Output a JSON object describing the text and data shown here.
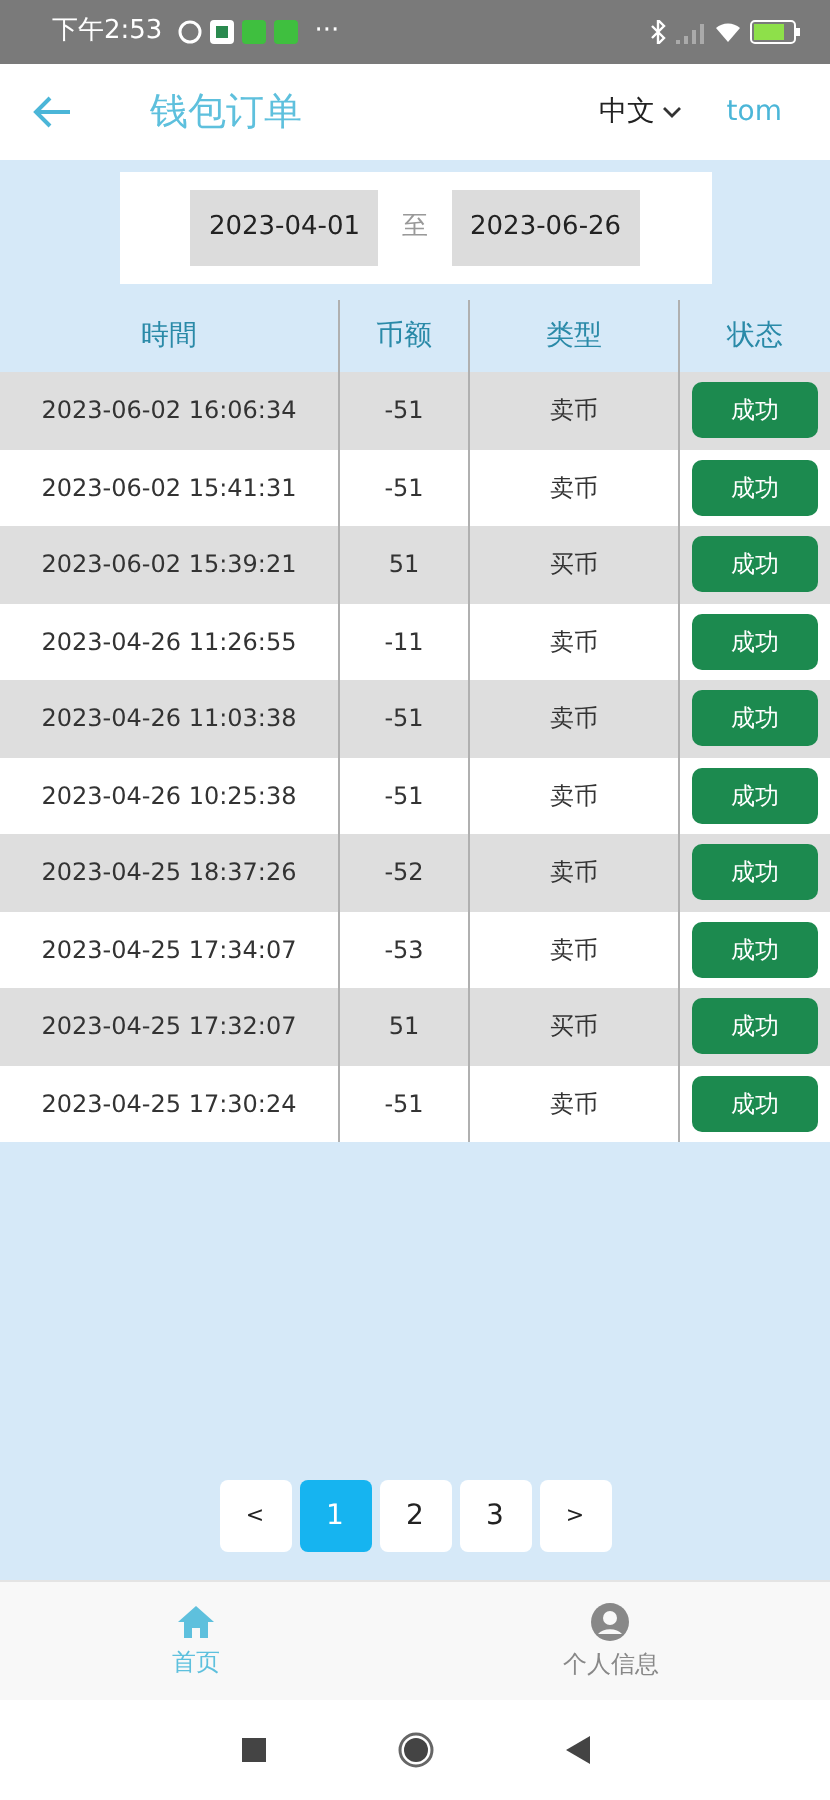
{
  "status_bar": {
    "time": "下午2:53",
    "more": "···"
  },
  "header": {
    "title": "钱包订单",
    "language": "中文",
    "user": "tom"
  },
  "date_range": {
    "start": "2023-04-01",
    "separator": "至",
    "end": "2023-06-26"
  },
  "table": {
    "columns": [
      "時間",
      "币额",
      "类型",
      "状态"
    ],
    "rows": [
      {
        "time": "2023-06-02 16:06:34",
        "amount": "-51",
        "type": "卖币",
        "status": "成功"
      },
      {
        "time": "2023-06-02 15:41:31",
        "amount": "-51",
        "type": "卖币",
        "status": "成功"
      },
      {
        "time": "2023-06-02 15:39:21",
        "amount": "51",
        "type": "买币",
        "status": "成功"
      },
      {
        "time": "2023-04-26 11:26:55",
        "amount": "-11",
        "type": "卖币",
        "status": "成功"
      },
      {
        "time": "2023-04-26 11:03:38",
        "amount": "-51",
        "type": "卖币",
        "status": "成功"
      },
      {
        "time": "2023-04-26 10:25:38",
        "amount": "-51",
        "type": "卖币",
        "status": "成功"
      },
      {
        "time": "2023-04-25 18:37:26",
        "amount": "-52",
        "type": "卖币",
        "status": "成功"
      },
      {
        "time": "2023-04-25 17:34:07",
        "amount": "-53",
        "type": "卖币",
        "status": "成功"
      },
      {
        "time": "2023-04-25 17:32:07",
        "amount": "51",
        "type": "买币",
        "status": "成功"
      },
      {
        "time": "2023-04-25 17:30:24",
        "amount": "-51",
        "type": "卖币",
        "status": "成功"
      }
    ]
  },
  "pagination": [
    {
      "label": "<",
      "kind": "prev",
      "selected": false
    },
    {
      "label": "1",
      "kind": "page",
      "selected": true
    },
    {
      "label": "2",
      "kind": "page",
      "selected": false
    },
    {
      "label": "3",
      "kind": "page",
      "selected": false
    },
    {
      "label": ">",
      "kind": "next",
      "selected": false
    }
  ],
  "bottom_nav": [
    {
      "label": "首页",
      "kind": "home",
      "selected": true
    },
    {
      "label": "个人信息",
      "kind": "profile",
      "selected": false
    }
  ]
}
